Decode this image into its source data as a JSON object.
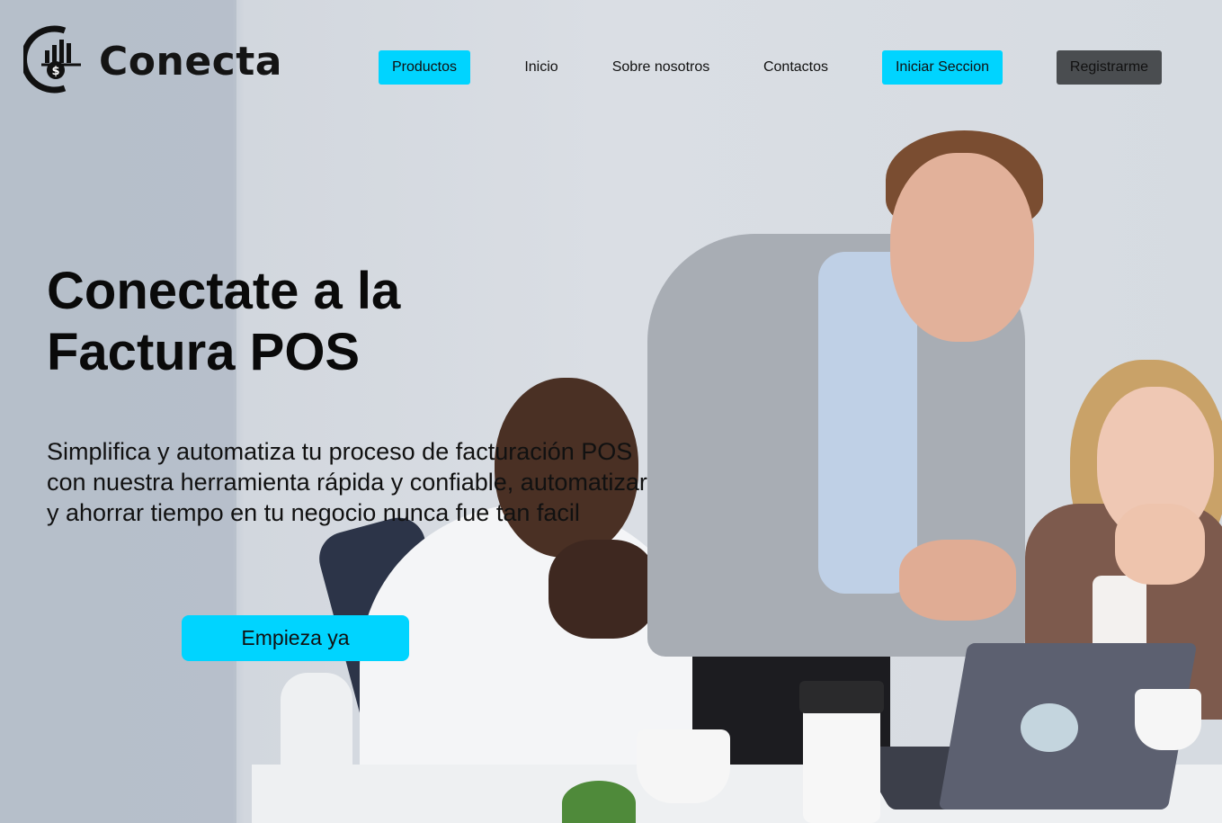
{
  "brand": {
    "name": "Conecta",
    "logo_icon": "coin-chart-logo-icon"
  },
  "nav": {
    "items": [
      {
        "label": "Productos",
        "style": "cyan"
      },
      {
        "label": "Inicio",
        "style": "plain"
      },
      {
        "label": "Sobre nosotros",
        "style": "plain"
      },
      {
        "label": "Contactos",
        "style": "plain"
      },
      {
        "label": "Iniciar Seccion",
        "style": "cyan"
      },
      {
        "label": "Registrarme",
        "style": "dark"
      }
    ]
  },
  "hero": {
    "title_line1": "Conectate a la",
    "title_line2": "Factura POS",
    "description": "Simplifica y automatiza tu proceso de facturación POS con nuestra herramienta rápida y confiable, automatizar y ahorrar tiempo en tu negocio nunca fue tan facil",
    "cta_label": "Empieza ya",
    "background_image": "team-meeting-laptop-photo"
  },
  "colors": {
    "accent": "#00d4ff",
    "dark_button": "#4a4d50",
    "text": "#111111"
  }
}
